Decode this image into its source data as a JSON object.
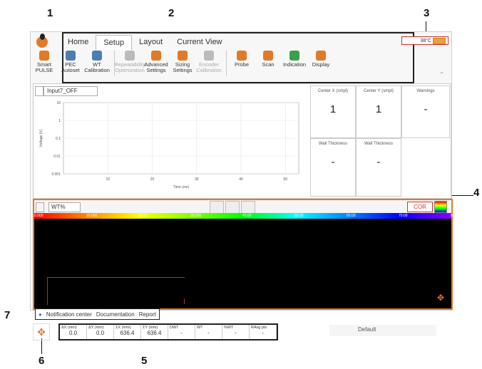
{
  "callouts": {
    "c1": "1",
    "c2": "2",
    "c3": "3",
    "c4": "4",
    "c5": "5",
    "c6": "6",
    "c7": "7"
  },
  "tabs": [
    "Home",
    "Setup",
    "Layout",
    "Current View"
  ],
  "active_tab": "Setup",
  "status": {
    "temperature": "38°C"
  },
  "ribbon": [
    {
      "label": "Smart PULSE",
      "disabled": false,
      "icon": "smart-pulse-icon",
      "color": "#e07a2b"
    },
    {
      "label": "PEC Autoset",
      "disabled": false,
      "icon": "pec-autoset-icon",
      "color": "#4a7fb0"
    },
    {
      "label": "WT Calibration",
      "disabled": false,
      "icon": "wt-calibration-icon",
      "color": "#4a7fb0"
    },
    {
      "label": "Repeatability Optimization",
      "disabled": true,
      "icon": "repeatability-icon",
      "color": "#bbbbbb"
    },
    {
      "label": "Advanced Settings",
      "disabled": false,
      "icon": "advanced-settings-icon",
      "color": "#e07a2b"
    },
    {
      "label": "Sizing Settings",
      "disabled": false,
      "icon": "sizing-settings-icon",
      "color": "#e07a2b"
    },
    {
      "label": "Encoder Calibration",
      "disabled": true,
      "icon": "encoder-calibration-icon",
      "color": "#bbbbbb"
    },
    {
      "label": "Probe",
      "disabled": false,
      "icon": "probe-icon",
      "color": "#e07a2b"
    },
    {
      "label": "Scan",
      "disabled": false,
      "icon": "scan-icon",
      "color": "#e07a2b"
    },
    {
      "label": "Indication",
      "disabled": false,
      "icon": "indication-icon",
      "color": "#3aa04a"
    },
    {
      "label": "Display",
      "disabled": false,
      "icon": "display-icon",
      "color": "#e07a2b"
    }
  ],
  "signal": {
    "dropdown": "Input7_OFF",
    "chart_data": {
      "type": "line",
      "xlabel": "Time (ms)",
      "ylabel": "Voltage (V)",
      "x_ticks": [
        "10",
        "20",
        "30",
        "40",
        "50"
      ],
      "y_ticks": [
        "10",
        "1",
        "0.1",
        "0.01",
        "0.001"
      ],
      "grid": true,
      "series": []
    }
  },
  "metrics": [
    {
      "title": "Center X (smpl)",
      "value": "1"
    },
    {
      "title": "Center Y (smpl)",
      "value": "1"
    },
    {
      "title": "Warnings",
      "value": "-"
    },
    {
      "title": "Wall Thickness",
      "value": "-"
    },
    {
      "title": "Wall Thickness",
      "value": "-"
    }
  ],
  "map": {
    "mode": "WT%",
    "cor_label": "COR",
    "scale_labels": [
      "0.000",
      "10.000",
      "20.00",
      "30.000",
      "40.00",
      "50.00",
      "60.00",
      "70.00",
      "80.00"
    ]
  },
  "notification_bar": [
    "Notification center",
    "Documentation",
    "Report"
  ],
  "readouts": [
    {
      "label": "ΔX (mm)",
      "value": "0.0"
    },
    {
      "label": "ΔY (mm)",
      "value": "0.0"
    },
    {
      "label": "ΣX (mm)",
      "value": "636.4"
    },
    {
      "label": "ΣY (mm)",
      "value": "636.4"
    },
    {
      "label": "DWT",
      "value": "-"
    },
    {
      "label": "WT",
      "value": "-"
    },
    {
      "label": "%WT",
      "value": "-"
    },
    {
      "label": "RAvg pts",
      "value": "-"
    }
  ],
  "preset": "Default"
}
